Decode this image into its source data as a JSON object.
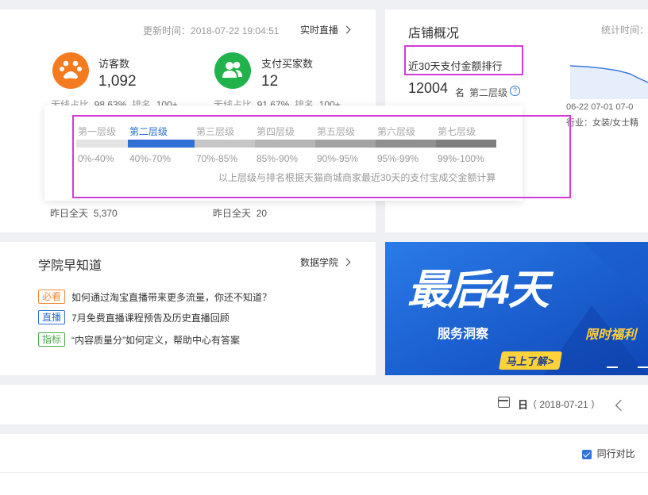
{
  "overview": {
    "update_prefix": "更新时间：",
    "update_time": "2018-07-22 19:04:51",
    "live_link": "实时直播",
    "visitors": {
      "label": "访客数",
      "value": "1,092",
      "sub_label": "无线占比",
      "sub_value": "98.63%",
      "rank_label": "排名",
      "rank_value": "100+",
      "yesterday_label": "昨日全天",
      "yesterday_value": "5,370"
    },
    "buyers": {
      "label": "支付买家数",
      "value": "12",
      "sub_label": "无线占比",
      "sub_value": "91.67%",
      "rank_label": "排名",
      "rank_value": "100+",
      "yesterday_label": "昨日全天",
      "yesterday_value": "20"
    }
  },
  "store": {
    "title": "店铺概况",
    "stats_time": "统计时间：",
    "rank_title": "近30天支付金额排行",
    "rank_value": "12004",
    "rank_unit": "名",
    "tier": "第二层级",
    "help_icon": "?",
    "chart_ticks": [
      "06-22",
      "07-01",
      "07-0"
    ],
    "industry": "行业：女装/女士精"
  },
  "tiers": {
    "labels": [
      "第一层级",
      "第二层级",
      "第三层级",
      "第四层级",
      "第五层级",
      "第六层级",
      "第七层级"
    ],
    "ranges": [
      "0%-40%",
      "40%-70%",
      "70%-85%",
      "85%-90%",
      "90%-95%",
      "95%-99%",
      "99%-100%"
    ],
    "colors": [
      "#e4e4e4",
      "#2f6fd6",
      "#c6c6c6",
      "#b5b5b5",
      "#a3a3a3",
      "#909090",
      "#7e7e7e"
    ],
    "active_index": 1,
    "note": "以上层级与排名根据天猫商城商家最近30天的支付宝成交金额计算"
  },
  "academy": {
    "title": "学院早知道",
    "link": "数据学院",
    "items": [
      {
        "tag": "必看",
        "tag_color": "#f08a3c",
        "text": "如何通过淘宝直播带来更多流量，你还不知道？"
      },
      {
        "tag": "直播",
        "tag_color": "#2f6fd6",
        "text": "7月免费直播课程预告及历史直播回顾"
      },
      {
        "tag": "指标",
        "tag_color": "#4aa84a",
        "text": "“内容质量分”如何定义，帮助中心有答案"
      }
    ]
  },
  "banner": {
    "headline": "最后4天",
    "service": "服务洞察",
    "promo": "限时福利",
    "cta": "马上了解>"
  },
  "datebar": {
    "period": "日",
    "date": "（ 2018-07-21 ）"
  },
  "table": {
    "compare_label": "同行对比"
  }
}
